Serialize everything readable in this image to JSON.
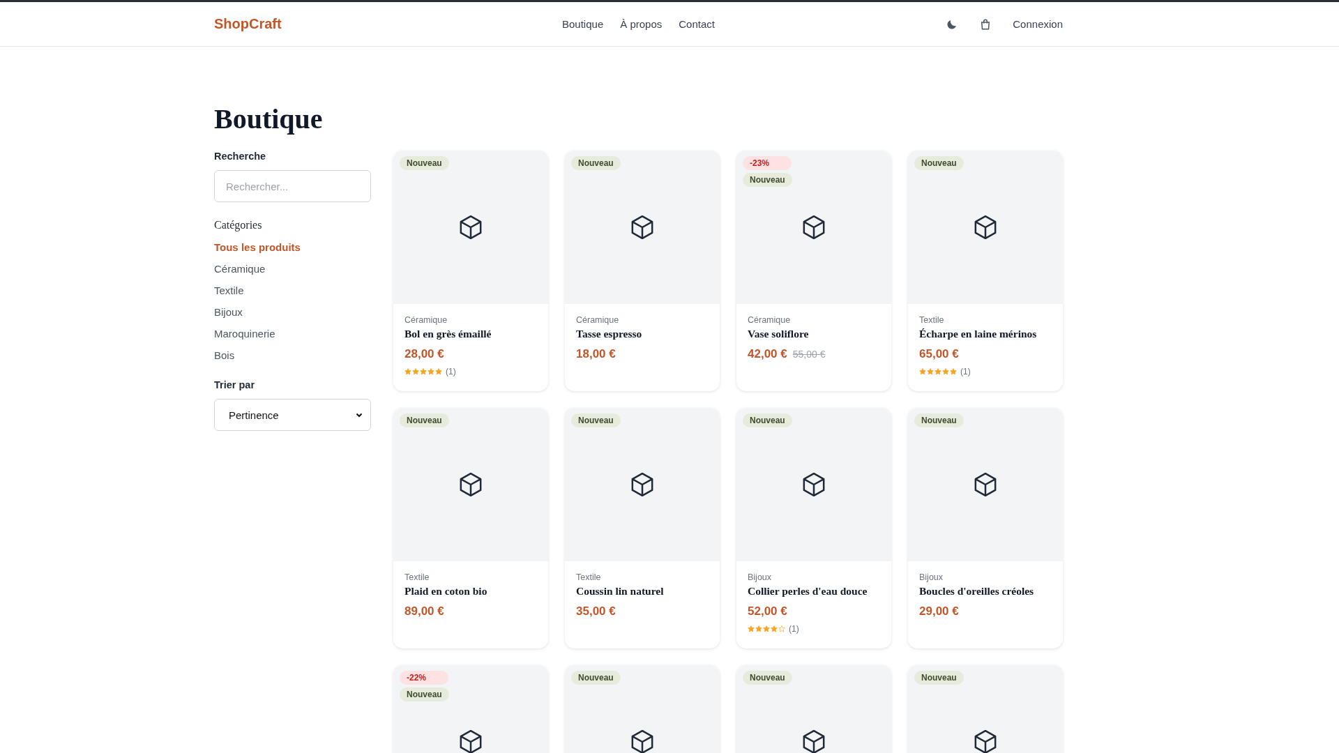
{
  "header": {
    "logo": "ShopCraft",
    "nav": [
      "Boutique",
      "À propos",
      "Contact"
    ],
    "login": "Connexion"
  },
  "page_title": "Boutique",
  "sidebar": {
    "search_label": "Recherche",
    "search": {
      "placeholder": "Rechercher..."
    },
    "categories_title": "Catégories",
    "categories": [
      {
        "label": "Tous les produits",
        "selected": true
      },
      {
        "label": "Céramique",
        "selected": false
      },
      {
        "label": "Textile",
        "selected": false
      },
      {
        "label": "Bijoux",
        "selected": false
      },
      {
        "label": "Maroquinerie",
        "selected": false
      },
      {
        "label": "Bois",
        "selected": false
      }
    ],
    "sort_label": "Trier par",
    "sort": {
      "value": "Pertinence"
    }
  },
  "products": [
    {
      "badges": [
        {
          "kind": "new",
          "text": "Nouveau"
        }
      ],
      "category": "Céramique",
      "name": "Bol en grès émaillé",
      "price": "28,00 €",
      "stars": 5,
      "reviews": "(1)"
    },
    {
      "badges": [
        {
          "kind": "new",
          "text": "Nouveau"
        }
      ],
      "category": "Céramique",
      "name": "Tasse espresso",
      "price": "18,00 €"
    },
    {
      "badges": [
        {
          "kind": "discount",
          "text": "-23%"
        },
        {
          "kind": "new",
          "text": "Nouveau"
        }
      ],
      "category": "Céramique",
      "name": "Vase soliflore",
      "price": "42,00 €",
      "old_price": "55,00 €"
    },
    {
      "badges": [
        {
          "kind": "new",
          "text": "Nouveau"
        }
      ],
      "category": "Textile",
      "name": "Écharpe en laine mérinos",
      "price": "65,00 €",
      "stars": 5,
      "reviews": "(1)"
    },
    {
      "badges": [
        {
          "kind": "new",
          "text": "Nouveau"
        }
      ],
      "category": "Textile",
      "name": "Plaid en coton bio",
      "price": "89,00 €"
    },
    {
      "badges": [
        {
          "kind": "new",
          "text": "Nouveau"
        }
      ],
      "category": "Textile",
      "name": "Coussin lin naturel",
      "price": "35,00 €"
    },
    {
      "badges": [
        {
          "kind": "new",
          "text": "Nouveau"
        }
      ],
      "category": "Bijoux",
      "name": "Collier perles d'eau douce",
      "price": "52,00 €",
      "stars": 4,
      "reviews": "(1)"
    },
    {
      "badges": [
        {
          "kind": "new",
          "text": "Nouveau"
        }
      ],
      "category": "Bijoux",
      "name": "Boucles d'oreilles créoles",
      "price": "29,00 €"
    },
    {
      "badges": [
        {
          "kind": "discount",
          "text": "-22%"
        },
        {
          "kind": "new",
          "text": "Nouveau"
        }
      ]
    },
    {
      "badges": [
        {
          "kind": "new",
          "text": "Nouveau"
        }
      ]
    },
    {
      "badges": [
        {
          "kind": "new",
          "text": "Nouveau"
        }
      ]
    },
    {
      "badges": [
        {
          "kind": "new",
          "text": "Nouveau"
        }
      ]
    }
  ]
}
